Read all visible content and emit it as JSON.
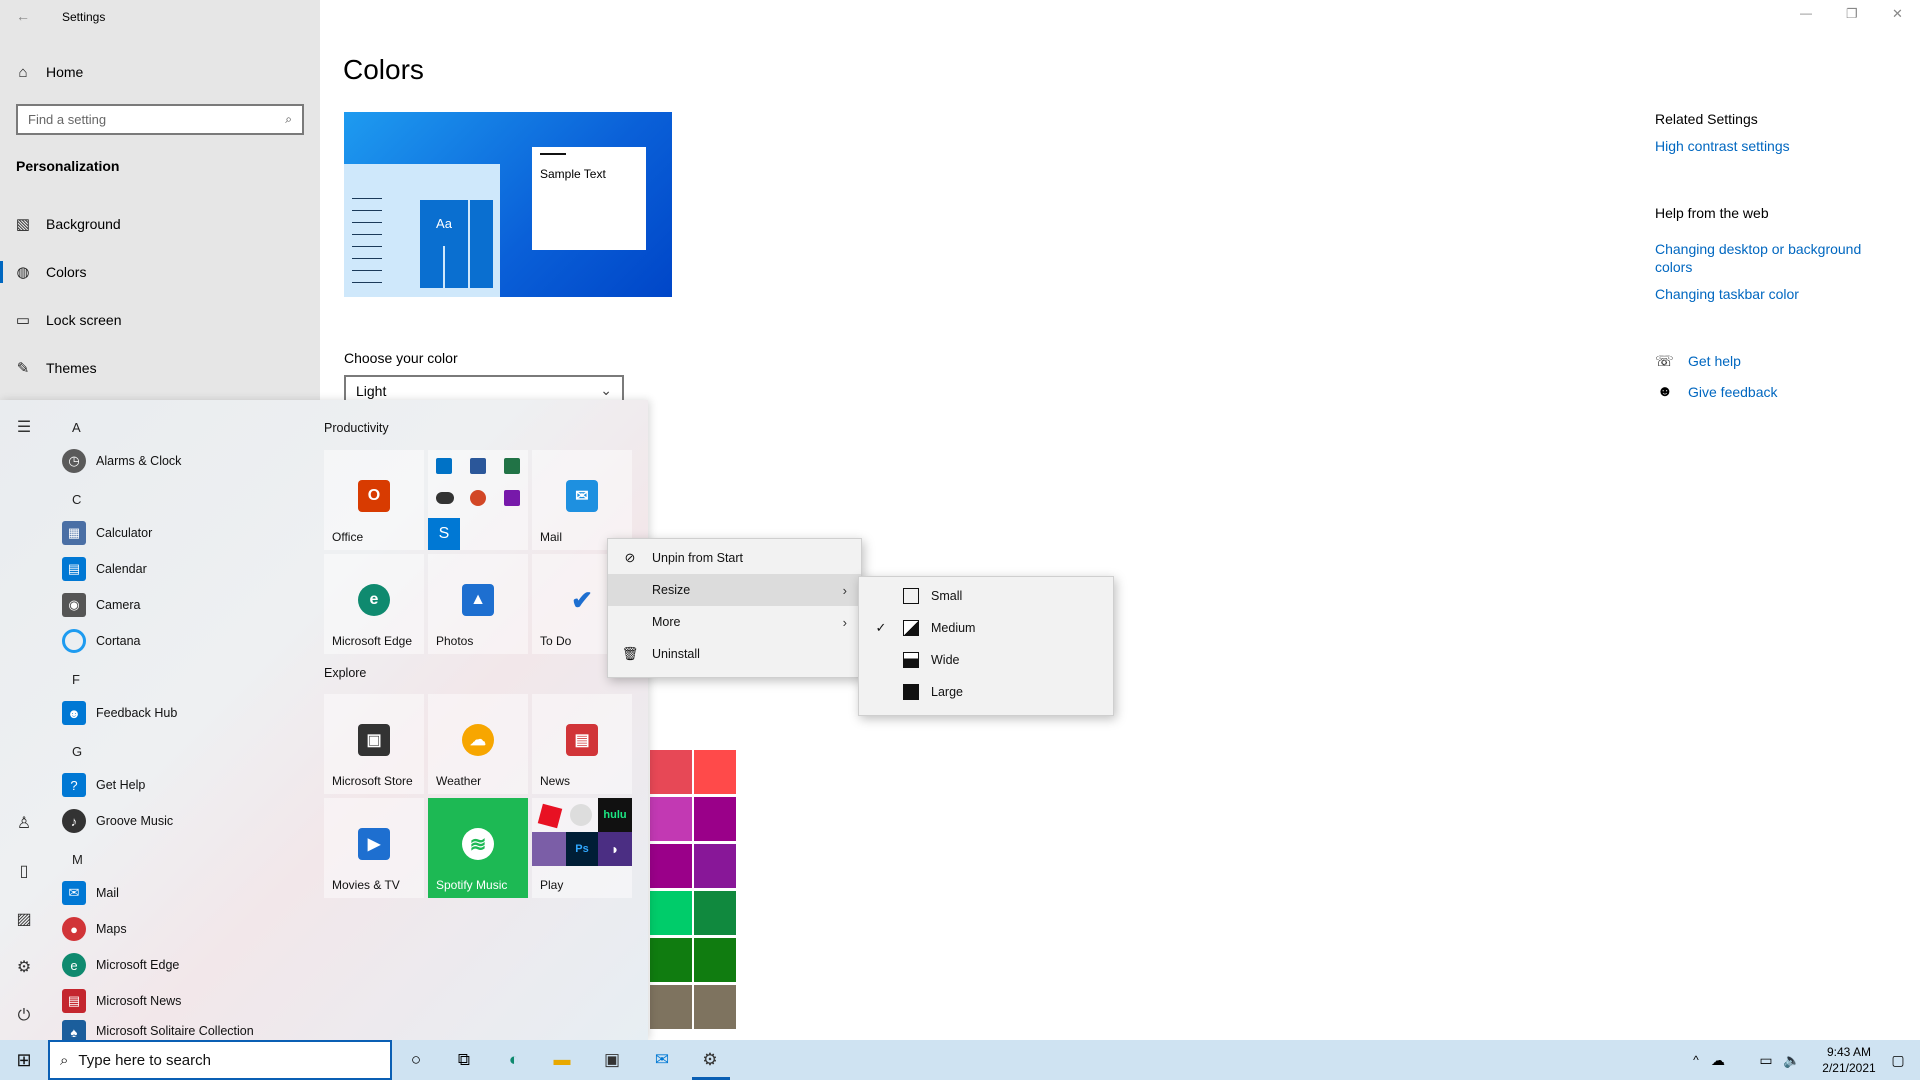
{
  "window": {
    "title": "Settings",
    "minimize": "—",
    "restore": "❐",
    "close": "✕",
    "back": "←"
  },
  "sidebar": {
    "home": "Home",
    "search_placeholder": "Find a setting",
    "section": "Personalization",
    "items": [
      {
        "label": "Background",
        "icon": "image-icon"
      },
      {
        "label": "Colors",
        "icon": "palette-icon"
      },
      {
        "label": "Lock screen",
        "icon": "lock-screen-icon"
      },
      {
        "label": "Themes",
        "icon": "brush-icon"
      }
    ]
  },
  "main": {
    "title": "Colors",
    "preview_sample": "Sample Text",
    "preview_tile": "Aa",
    "choose_label": "Choose your color",
    "choose_value": "Light"
  },
  "related": {
    "heading": "Related Settings",
    "link1": "High contrast settings",
    "help_heading": "Help from the web",
    "help_link1": "Changing desktop or background colors",
    "help_link2": "Changing taskbar color",
    "get_help": "Get help",
    "give_feedback": "Give feedback"
  },
  "start_menu": {
    "apps": [
      {
        "letter": "A"
      },
      {
        "label": "Alarms & Clock",
        "color": "#5a5a5a"
      },
      {
        "letter": "C"
      },
      {
        "label": "Calculator",
        "color": "#4a6fa5"
      },
      {
        "label": "Calendar",
        "color": "#0078d4"
      },
      {
        "label": "Camera",
        "color": "#555555"
      },
      {
        "label": "Cortana",
        "color": "#ffffff"
      },
      {
        "letter": "F"
      },
      {
        "label": "Feedback Hub",
        "color": "#0078d4"
      },
      {
        "letter": "G"
      },
      {
        "label": "Get Help",
        "color": "#0078d4"
      },
      {
        "label": "Groove Music",
        "color": "#333333"
      },
      {
        "letter": "M"
      },
      {
        "label": "Mail",
        "color": "#0078d4"
      },
      {
        "label": "Maps",
        "color": "#d13438"
      },
      {
        "label": "Microsoft Edge",
        "color": "#0f8a6f"
      },
      {
        "label": "Microsoft News",
        "color": "#c4262e"
      },
      {
        "label": "Microsoft Solitaire Collection",
        "color": "#1b5e9c"
      }
    ],
    "groups": {
      "productivity": "Productivity",
      "explore": "Explore"
    },
    "tiles": {
      "office": "Office",
      "mail": "Mail",
      "edge": "Microsoft Edge",
      "photos": "Photos",
      "todo": "To Do",
      "store": "Microsoft Store",
      "weather": "Weather",
      "news": "News",
      "movies": "Movies & TV",
      "spotify": "Spotify Music",
      "play": "Play",
      "hulu": "hulu"
    }
  },
  "context_menu": {
    "unpin": "Unpin from Start",
    "resize": "Resize",
    "more": "More",
    "uninstall": "Uninstall"
  },
  "resize_menu": {
    "small": "Small",
    "medium": "Medium",
    "wide": "Wide",
    "large": "Large",
    "checked": "✓"
  },
  "taskbar": {
    "search_placeholder": "Type here to search",
    "time": "9:43 AM",
    "date": "2/21/2021"
  }
}
